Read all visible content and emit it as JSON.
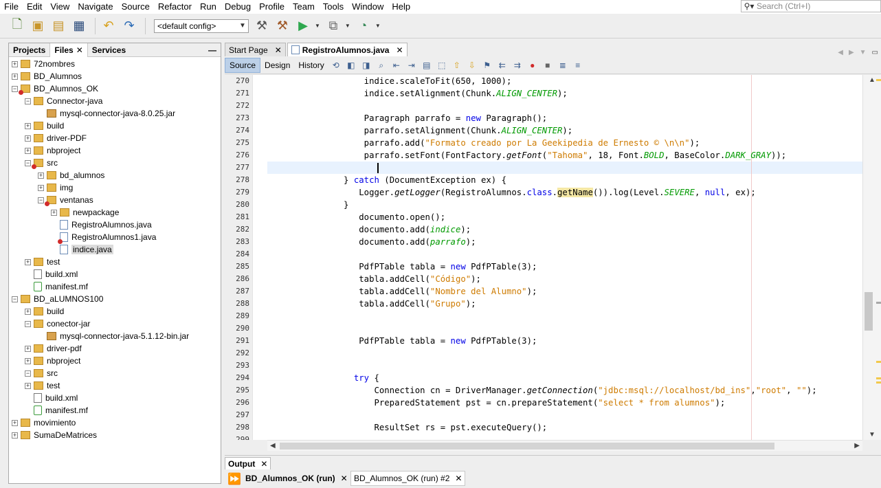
{
  "menu": [
    "File",
    "Edit",
    "View",
    "Navigate",
    "Source",
    "Refactor",
    "Run",
    "Debug",
    "Profile",
    "Team",
    "Tools",
    "Window",
    "Help"
  ],
  "search": {
    "placeholder": "Search (Ctrl+I)"
  },
  "toolbar": {
    "config": "<default config>"
  },
  "left_panel": {
    "tabs": [
      "Projects",
      "Files",
      "Services"
    ],
    "tree": [
      {
        "label": "72nombres",
        "depth": 0,
        "icon": "folder"
      },
      {
        "label": "BD_Alumnos",
        "depth": 0,
        "icon": "folder"
      },
      {
        "label": "BD_Alumnos_OK",
        "depth": 0,
        "icon": "folder-error"
      },
      {
        "label": "Connector-java",
        "depth": 1,
        "icon": "folder"
      },
      {
        "label": "mysql-connector-java-8.0.25.jar",
        "depth": 2,
        "icon": "jar"
      },
      {
        "label": "build",
        "depth": 1,
        "icon": "folder"
      },
      {
        "label": "driver-PDF",
        "depth": 1,
        "icon": "folder"
      },
      {
        "label": "nbproject",
        "depth": 1,
        "icon": "folder"
      },
      {
        "label": "src",
        "depth": 1,
        "icon": "folder-error"
      },
      {
        "label": "bd_alumnos",
        "depth": 2,
        "icon": "folder"
      },
      {
        "label": "img",
        "depth": 2,
        "icon": "folder"
      },
      {
        "label": "ventanas",
        "depth": 2,
        "icon": "folder-error"
      },
      {
        "label": "newpackage",
        "depth": 3,
        "icon": "folder"
      },
      {
        "label": "RegistroAlumnos.java",
        "depth": 3,
        "icon": "java"
      },
      {
        "label": "RegistroAlumnos1.java",
        "depth": 3,
        "icon": "java-error"
      },
      {
        "label": "indice.java",
        "depth": 3,
        "icon": "java",
        "selected": true
      },
      {
        "label": "test",
        "depth": 1,
        "icon": "folder"
      },
      {
        "label": "build.xml",
        "depth": 1,
        "icon": "xml"
      },
      {
        "label": "manifest.mf",
        "depth": 1,
        "icon": "mf"
      },
      {
        "label": "BD_aLUMNOS100",
        "depth": 0,
        "icon": "folder"
      },
      {
        "label": "build",
        "depth": 1,
        "icon": "folder"
      },
      {
        "label": "conector-jar",
        "depth": 1,
        "icon": "folder"
      },
      {
        "label": "mysql-connector-java-5.1.12-bin.jar",
        "depth": 2,
        "icon": "jar"
      },
      {
        "label": "driver-pdf",
        "depth": 1,
        "icon": "folder"
      },
      {
        "label": "nbproject",
        "depth": 1,
        "icon": "folder"
      },
      {
        "label": "src",
        "depth": 1,
        "icon": "folder"
      },
      {
        "label": "test",
        "depth": 1,
        "icon": "folder"
      },
      {
        "label": "build.xml",
        "depth": 1,
        "icon": "xml"
      },
      {
        "label": "manifest.mf",
        "depth": 1,
        "icon": "mf"
      },
      {
        "label": "movimiento",
        "depth": 0,
        "icon": "folder"
      },
      {
        "label": "SumaDeMatrices",
        "depth": 0,
        "icon": "folder"
      }
    ]
  },
  "editor_tabs": [
    {
      "label": "Start Page"
    },
    {
      "label": "RegistroAlumnos.java",
      "active": true
    }
  ],
  "editor_toolbar": {
    "source": "Source",
    "design": "Design",
    "history": "History"
  },
  "code": [
    {
      "n": "270",
      "html": "                   indice.scaleToFit(650, 1000);"
    },
    {
      "n": "271",
      "html": "                   indice.setAlignment(Chunk.<span class=\"it\">ALIGN_CENTER</span>);"
    },
    {
      "n": "272",
      "html": ""
    },
    {
      "n": "273",
      "html": "                   Paragraph parrafo = <span class=\"kw\">new</span> Paragraph();"
    },
    {
      "n": "274",
      "html": "                   parrafo.setAlignment(Chunk.<span class=\"it\">ALIGN_CENTER</span>);"
    },
    {
      "n": "275",
      "html": "                   parrafo.add(<span class=\"st\">\"Formato creado por La Geekipedia de Ernesto © \\n\\n\"</span>);"
    },
    {
      "n": "276",
      "html": "                   parrafo.setFont(FontFactory.<span class=\"itb\">getFont</span>(<span class=\"st\">\"Tahoma\"</span>, 18, Font.<span class=\"it\">BOLD</span>, BaseColor.<span class=\"it\">DARK_GRAY</span>));"
    },
    {
      "n": "277",
      "html": ""
    },
    {
      "n": "278",
      "html": "               } <span class=\"kw\">catch</span> (DocumentException ex) {"
    },
    {
      "n": "279",
      "html": "                  Logger.<span class=\"itb\">getLogger</span>(RegistroAlumnos.<span class=\"kw\">class</span>.<span class=\"hl\">getName</span>()).log(Level.<span class=\"it\">SEVERE</span>, <span class=\"kw\">null</span>, ex);"
    },
    {
      "n": "280",
      "html": "               }"
    },
    {
      "n": "281",
      "html": "                  documento.open();"
    },
    {
      "n": "282",
      "html": "                  documento.add(<span class=\"it\">indice</span>);"
    },
    {
      "n": "283",
      "html": "                  documento.add(<span class=\"it\">parrafo</span>);"
    },
    {
      "n": "284",
      "html": ""
    },
    {
      "n": "285",
      "html": "                  PdfPTable tabla = <span class=\"kw\">new</span> PdfPTable(3);"
    },
    {
      "n": "286",
      "html": "                  tabla.addCell(<span class=\"st\">\"Código\"</span>);"
    },
    {
      "n": "287",
      "html": "                  tabla.addCell(<span class=\"st\">\"Nombre del Alumno\"</span>);"
    },
    {
      "n": "288",
      "html": "                  tabla.addCell(<span class=\"st\">\"Grupo\"</span>);"
    },
    {
      "n": "289",
      "html": ""
    },
    {
      "n": "290",
      "html": ""
    },
    {
      "n": "291",
      "html": "                  PdfPTable tabla = <span class=\"kw\">new</span> PdfPTable(3);"
    },
    {
      "n": "292",
      "html": ""
    },
    {
      "n": "293",
      "html": ""
    },
    {
      "n": "294",
      "html": "                 <span class=\"kw\">try</span> {"
    },
    {
      "n": "295",
      "html": "                     Connection cn = DriverManager.<span class=\"itb\">getConnection</span>(<span class=\"st\">\"jdbc:msql://localhost/bd_ins\"</span>,<span class=\"st\">\"root\"</span>, <span class=\"st\">\"\"</span>);"
    },
    {
      "n": "296",
      "html": "                     PreparedStatement pst = cn.prepareStatement(<span class=\"st\">\"select * from alumnos\"</span>);"
    },
    {
      "n": "297",
      "html": ""
    },
    {
      "n": "298",
      "html": "                     ResultSet rs = pst.executeQuery();"
    },
    {
      "n": "299",
      "html": ""
    }
  ],
  "output": {
    "title": "Output",
    "tabs": [
      "BD_Alumnos_OK (run)",
      "BD_Alumnos_OK (run) #2"
    ]
  }
}
